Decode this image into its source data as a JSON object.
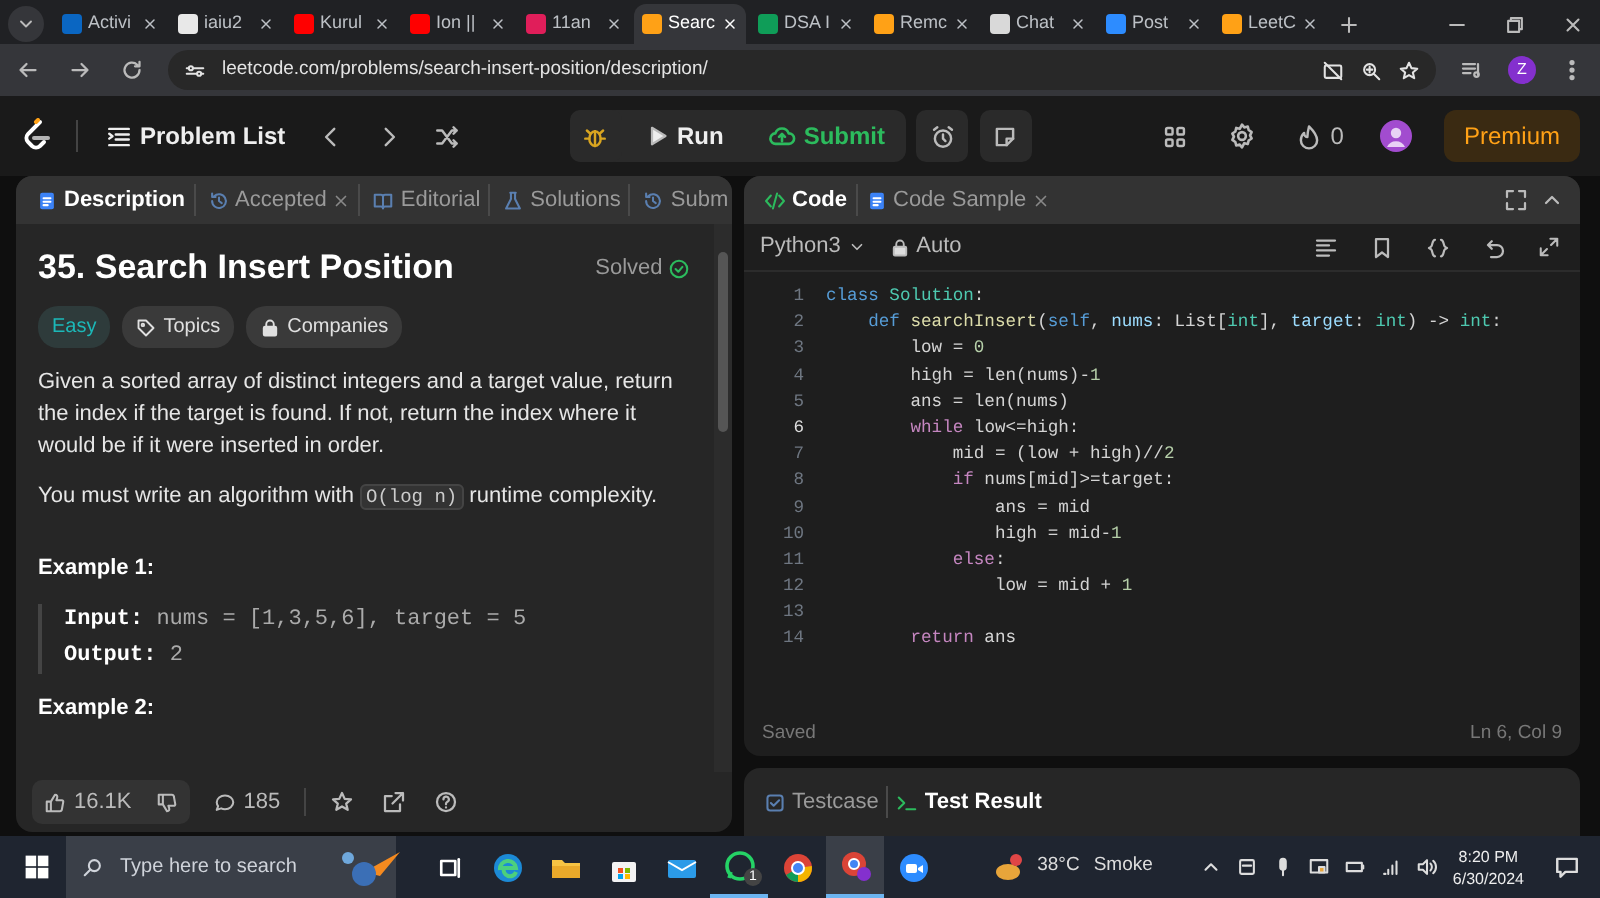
{
  "browser_tabs": [
    {
      "title": "Activi",
      "selected": false,
      "color": "#0a66c2"
    },
    {
      "title": "iaiu2",
      "selected": false,
      "color": "#e8e8e8"
    },
    {
      "title": "Kurul",
      "selected": false,
      "color": "#ff0000"
    },
    {
      "title": "Ion ||",
      "selected": false,
      "color": "#ff0000"
    },
    {
      "title": "11an",
      "selected": false,
      "color": "#e01e5a"
    },
    {
      "title": "Searc",
      "selected": true,
      "color": "#ffa116"
    },
    {
      "title": "DSA I",
      "selected": false,
      "color": "#0f9d58"
    },
    {
      "title": "Remc",
      "selected": false,
      "color": "#ffa116"
    },
    {
      "title": "Chat",
      "selected": false,
      "color": "#d9d9d9"
    },
    {
      "title": "Post",
      "selected": false,
      "color": "#2d8cff"
    },
    {
      "title": "LeetC",
      "selected": false,
      "color": "#ffa116"
    }
  ],
  "address_bar": {
    "url": "leetcode.com/problems/search-insert-position/description/",
    "profile": "Z"
  },
  "header": {
    "problem_list": "Problem List",
    "run": "Run",
    "submit": "Submit",
    "streak": "0",
    "premium": "Premium"
  },
  "description_panel": {
    "tabs": [
      {
        "label": "Description",
        "selected": true,
        "closable": false
      },
      {
        "label": "Accepted",
        "selected": false,
        "closable": true
      },
      {
        "label": "Editorial",
        "selected": false,
        "closable": false
      },
      {
        "label": "Solutions",
        "selected": false,
        "closable": false
      },
      {
        "label": "Subm",
        "selected": false,
        "closable": false
      }
    ],
    "title": "35. Search Insert Position",
    "status": "Solved",
    "tags": [
      {
        "label": "Easy",
        "kind": "difficulty"
      },
      {
        "label": "Topics",
        "kind": "topics"
      },
      {
        "label": "Companies",
        "kind": "companies"
      }
    ],
    "paragraph": "Given a sorted array of distinct integers and a target value, return the index if the target is found. If not, return the index where it would be if it were inserted in order.",
    "complexity_sentence": {
      "before": "You must write an algorithm with",
      "code": "O(log n)",
      "after": "runtime complexity."
    },
    "examples": [
      {
        "heading": "Example 1:",
        "lines": [
          "**Input:** nums = [1,3,5,6], target = 5",
          "**Output:** 2"
        ]
      },
      {
        "heading": "Example 2:"
      }
    ],
    "likes": "16.1K",
    "comments": "185"
  },
  "code_panel": {
    "tabs": [
      {
        "label": "Code",
        "selected": true,
        "closable": false
      },
      {
        "label": "Code Sample",
        "selected": false,
        "closable": true
      }
    ],
    "language": "Python3",
    "mode": "Auto",
    "lines": [
      {
        "number": "1",
        "current": false,
        "tokens": [
          {
            "kind": "decl",
            "text": "class"
          },
          {
            "kind": "type",
            "text": " Solution"
          },
          {
            "kind": "plain",
            "text": ":"
          }
        ]
      },
      {
        "number": "2",
        "current": false,
        "tokens": [
          {
            "kind": "decl",
            "text": "    def"
          },
          {
            "kind": "name",
            "text": " searchInsert"
          },
          {
            "kind": "plain",
            "text": "("
          },
          {
            "kind": "decl",
            "text": "self"
          },
          {
            "kind": "plain",
            "text": ", "
          },
          {
            "kind": "param",
            "text": "nums"
          },
          {
            "kind": "plain",
            "text": ": List["
          },
          {
            "kind": "type",
            "text": "int"
          },
          {
            "kind": "plain",
            "text": "], "
          },
          {
            "kind": "param",
            "text": "target"
          },
          {
            "kind": "plain",
            "text": ": "
          },
          {
            "kind": "type",
            "text": "int"
          },
          {
            "kind": "plain",
            "text": ") -> "
          },
          {
            "kind": "type",
            "text": "int"
          },
          {
            "kind": "plain",
            "text": ":"
          }
        ]
      },
      {
        "number": "3",
        "current": false,
        "tokens": [
          {
            "kind": "plain",
            "text": "        low = "
          },
          {
            "kind": "num",
            "text": "0"
          }
        ]
      },
      {
        "number": "4",
        "current": false,
        "tokens": [
          {
            "kind": "plain",
            "text": "        high = len(nums)-"
          },
          {
            "kind": "num",
            "text": "1"
          }
        ]
      },
      {
        "number": "5",
        "current": false,
        "tokens": [
          {
            "kind": "plain",
            "text": "        ans = len(nums)"
          }
        ]
      },
      {
        "number": "6",
        "current": true,
        "tokens": [
          {
            "kind": "kw",
            "text": "        while"
          },
          {
            "kind": "plain",
            "text": " low<=high:"
          }
        ]
      },
      {
        "number": "7",
        "current": false,
        "tokens": [
          {
            "kind": "plain",
            "text": "            mid = (low + high)//"
          },
          {
            "kind": "num",
            "text": "2"
          }
        ]
      },
      {
        "number": "8",
        "current": false,
        "tokens": [
          {
            "kind": "kw",
            "text": "            if"
          },
          {
            "kind": "plain",
            "text": " nums[mid]>=target:"
          }
        ]
      },
      {
        "number": "9",
        "current": false,
        "tokens": [
          {
            "kind": "plain",
            "text": "                ans = mid"
          }
        ]
      },
      {
        "number": "10",
        "current": false,
        "tokens": [
          {
            "kind": "plain",
            "text": "                high = mid-"
          },
          {
            "kind": "num",
            "text": "1"
          }
        ]
      },
      {
        "number": "11",
        "current": false,
        "tokens": [
          {
            "kind": "kw",
            "text": "            else"
          },
          {
            "kind": "plain",
            "text": ":"
          }
        ]
      },
      {
        "number": "12",
        "current": false,
        "tokens": [
          {
            "kind": "plain",
            "text": "                low = mid + "
          },
          {
            "kind": "num",
            "text": "1"
          }
        ]
      },
      {
        "number": "13",
        "current": false
      },
      {
        "number": "14",
        "current": false,
        "tokens": [
          {
            "kind": "kw",
            "text": "        return"
          },
          {
            "kind": "plain",
            "text": " ans"
          }
        ]
      }
    ],
    "save_status": "Saved",
    "cursor": "Ln 6, Col 9"
  },
  "test_panel": {
    "tabs": [
      {
        "label": "Testcase",
        "selected": false
      },
      {
        "label": "Test Result",
        "selected": true
      }
    ]
  },
  "taskbar": {
    "search_placeholder": "Type here to search",
    "whatsapp_badge": "1",
    "temperature": "38°C",
    "condition": "Smoke",
    "time": "8:20 PM",
    "date": "6/30/2024"
  }
}
